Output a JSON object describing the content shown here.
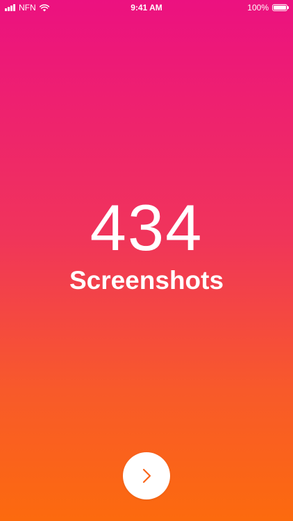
{
  "status_bar": {
    "carrier": "NFN",
    "time": "9:41 AM",
    "battery_text": "100%",
    "battery_level": 1.0,
    "icons": [
      "signal-icon",
      "wifi-icon",
      "battery-icon"
    ]
  },
  "main": {
    "count": "434",
    "label": "Screenshots"
  },
  "next_button": {
    "icon": "chevron-right-icon"
  },
  "colors": {
    "gradient_top": "#ec1180",
    "gradient_bottom": "#fc6a0e",
    "accent": "#f9661a",
    "text": "#ffffff"
  }
}
